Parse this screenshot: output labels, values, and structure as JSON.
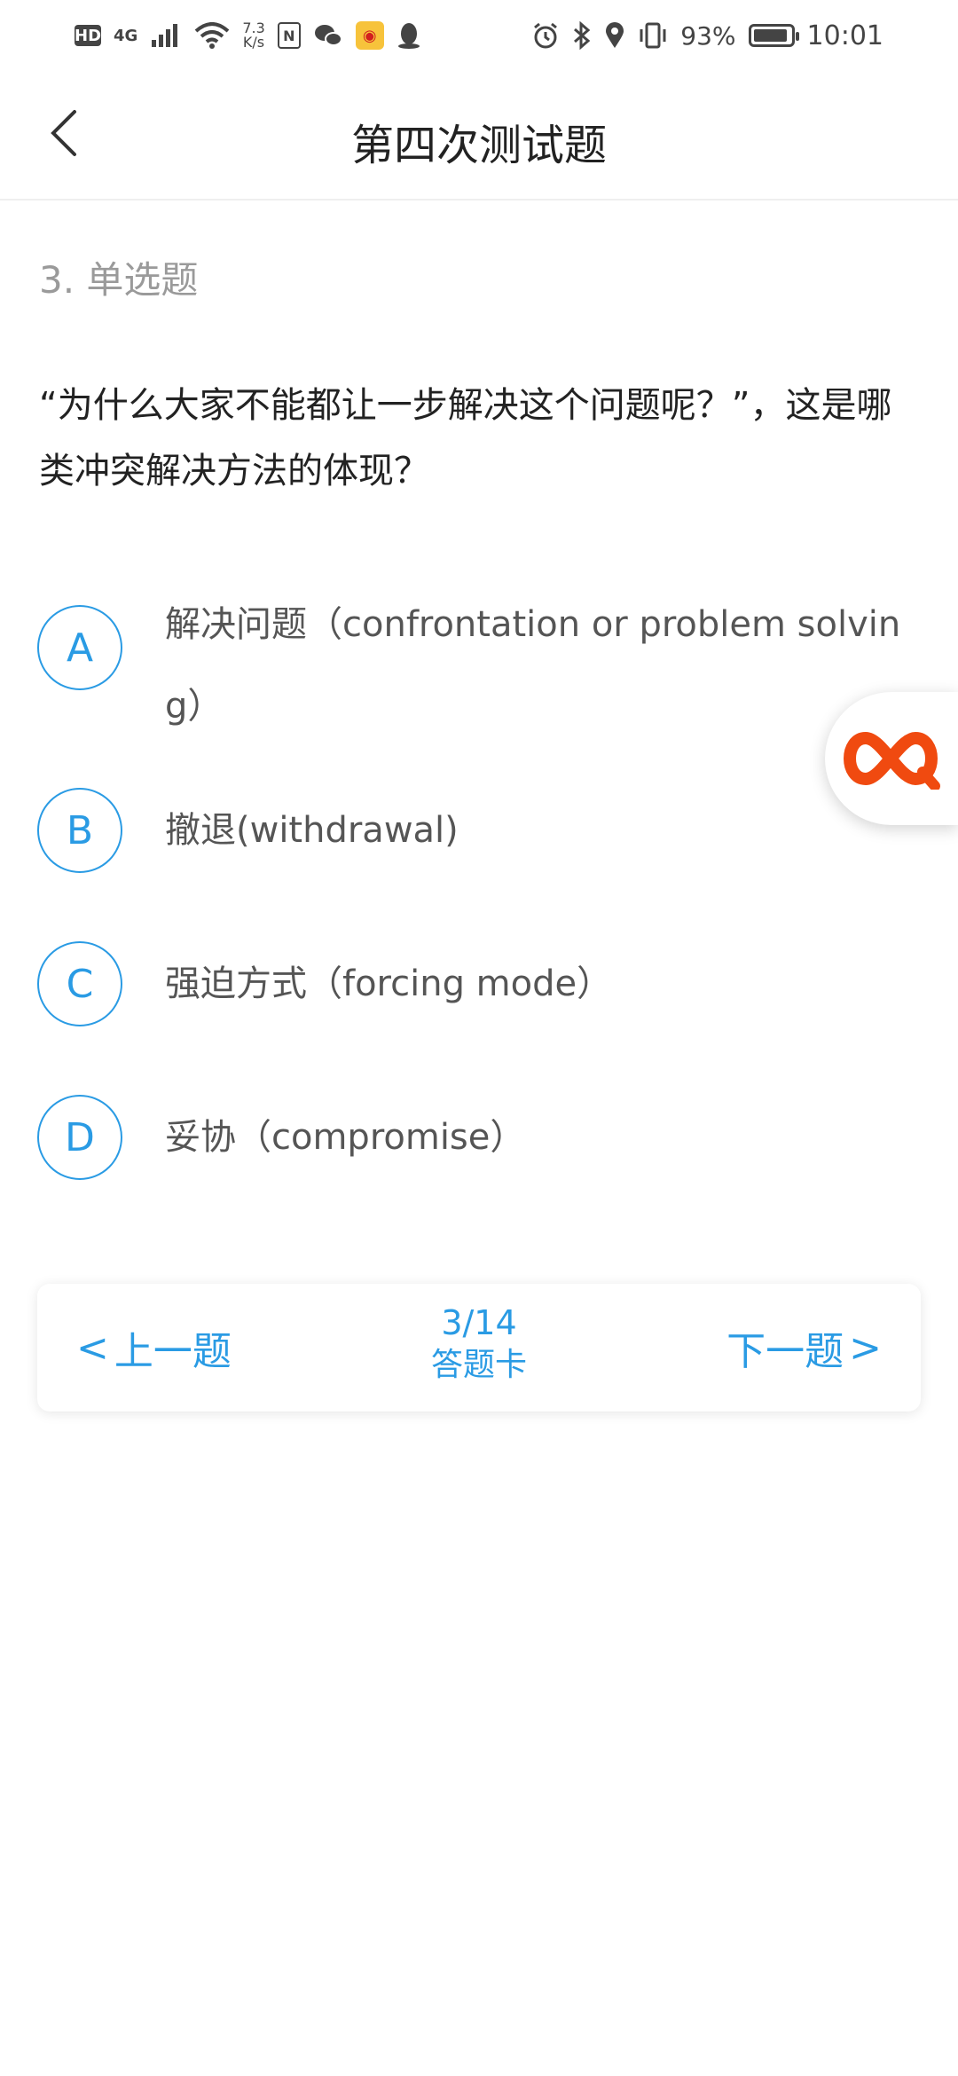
{
  "status_bar": {
    "hd": "HD",
    "network": "4G",
    "speed_value": "7.3",
    "speed_unit": "K/s",
    "battery_percent": "93%",
    "battery_level": 0.93,
    "time": "10:01"
  },
  "nav": {
    "title": "第四次测试题"
  },
  "question": {
    "type": "3. 单选题",
    "stem": "“为什么大家不能都让一步解决这个问题呢？”，这是哪类冲突解决方法的体现？",
    "options": [
      {
        "letter": "A",
        "text": "解决问题（confrontation or problem solving）"
      },
      {
        "letter": "B",
        "text": "撤退(withdrawal)"
      },
      {
        "letter": "C",
        "text": "强迫方式（forcing mode）"
      },
      {
        "letter": "D",
        "text": "妥协（compromise）"
      }
    ]
  },
  "pager": {
    "prev_label": "上一题",
    "next_label": "下一题",
    "count": "3/14",
    "card_label": "答题卡"
  },
  "colors": {
    "accent": "#2a9be4",
    "float_brand": "#f04a10"
  }
}
